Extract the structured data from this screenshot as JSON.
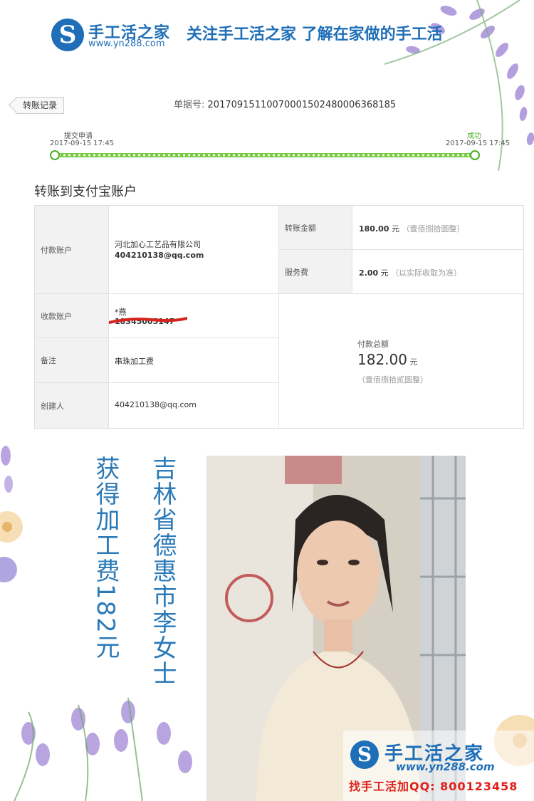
{
  "header": {
    "brand": "手工活之家",
    "url": "www.yn288.com",
    "slogan": "关注手工活之家 了解在家做的手工活"
  },
  "record": {
    "tab_label": "转账记录",
    "doc_label": "单据号:",
    "doc_no": "20170915110070001502480006368185",
    "step_start_label": "提交申请",
    "step_start_time": "2017-09-15 17:45",
    "step_end_label": "成功",
    "step_end_time": "2017-09-15 17:45",
    "section_title": "转账到支付宝账户"
  },
  "table": {
    "payer_label": "付款账户",
    "payer_name": "河北加心工艺品有限公司",
    "payer_email": "404210138@qq.com",
    "amount_label": "转账金额",
    "amount": "180.00",
    "amount_unit": "元",
    "amount_words": "（壹佰捌拾圆整）",
    "fee_label": "服务费",
    "fee": "2.00",
    "fee_unit": "元",
    "fee_note": "（以实际收取为准）",
    "payee_label": "收款账户",
    "payee_name": "*燕",
    "payee_account": "18345005147",
    "remark_label": "备注",
    "remark": "串珠加工费",
    "creator_label": "创建人",
    "creator": "404210138@qq.com",
    "total_label": "付款总额",
    "total": "182.00",
    "total_unit": "元",
    "total_words": "（壹佰捌拾贰圆整）"
  },
  "captions": {
    "col1": "吉林省德惠市李女士",
    "col2": "获得加工费182元"
  },
  "watermark": {
    "brand": "手工活之家",
    "url": "www.yn288.com",
    "contact": "找手工活加QQ: 800123458"
  },
  "colors": {
    "brand_blue": "#1f6fb8",
    "progress_green": "#7ac943",
    "success_green": "#4caf28",
    "contact_red": "#e0201c",
    "redline": "#d6231c"
  }
}
